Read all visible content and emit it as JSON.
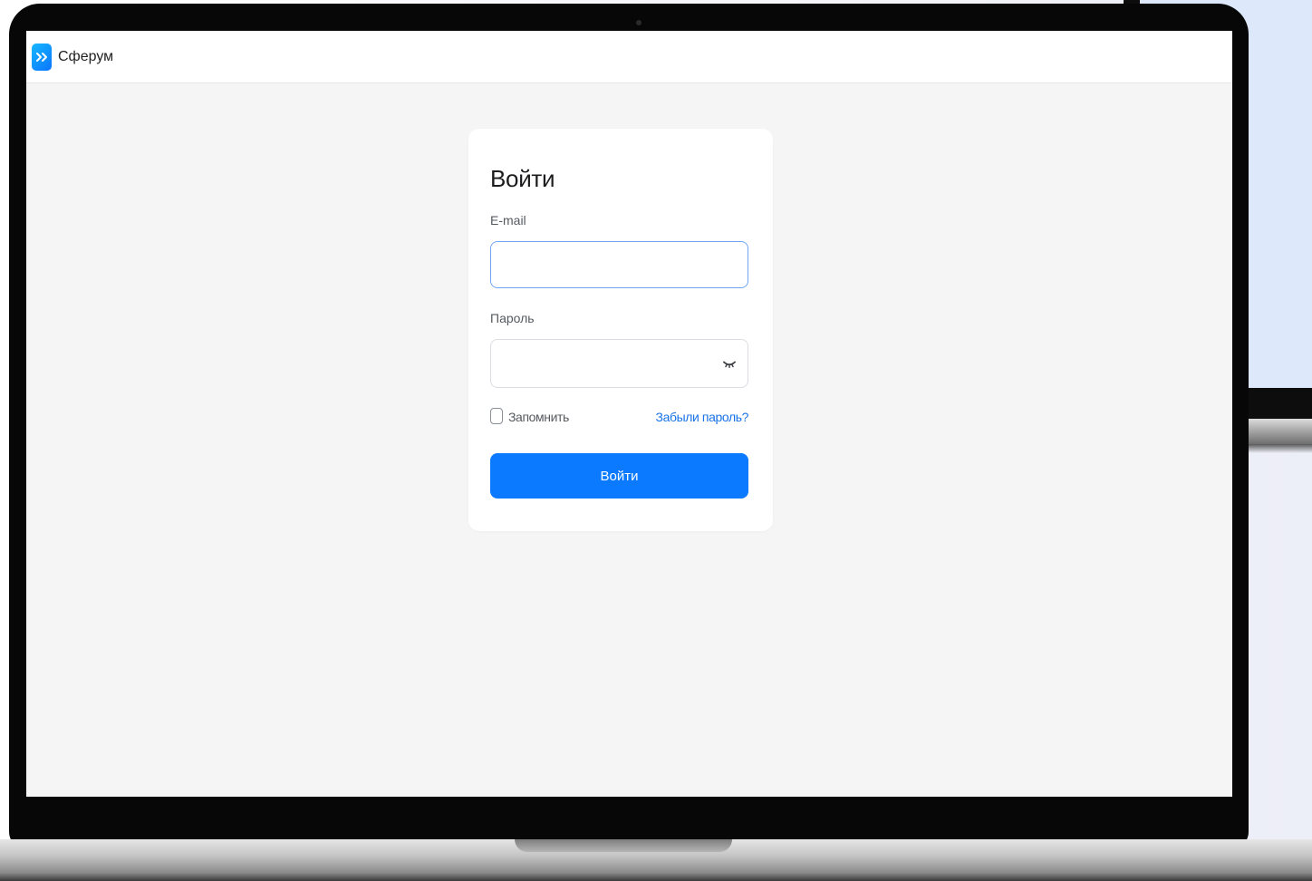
{
  "app": {
    "brand_name": "Сферум",
    "logo_icon": "double-chevron-right-icon",
    "accent_color": "#0b7aff"
  },
  "login": {
    "title": "Войти",
    "email": {
      "label": "E-mail",
      "value": "",
      "placeholder": ""
    },
    "password": {
      "label": "Пароль",
      "value": "",
      "placeholder": "",
      "toggle_icon": "eye-closed-icon"
    },
    "remember": {
      "label": "Запомнить",
      "checked": false
    },
    "forgot_link": "Забыли пароль?",
    "submit_label": "Войти"
  }
}
